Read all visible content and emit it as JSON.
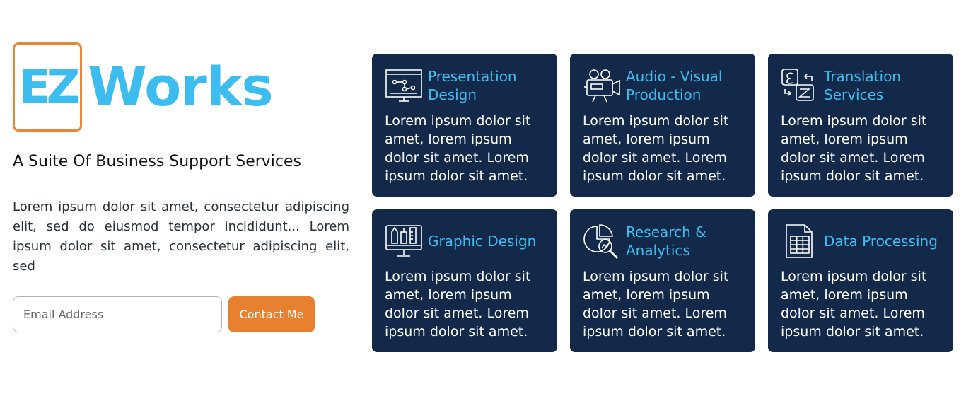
{
  "brand": {
    "logo_ez": "EZ",
    "logo_works": "Works",
    "tagline": "A Suite Of Business Support Services"
  },
  "intro": {
    "text": "Lorem ipsum dolor sit amet, consectetur adipiscing elit, sed do eiusmod tempor incididunt... Lorem ipsum dolor sit amet, consectetur adipiscing elit, sed"
  },
  "contact": {
    "email_placeholder": "Email Address",
    "button_label": "Contact Me"
  },
  "services": [
    {
      "title": "Presentation Design",
      "icon": "presentation-icon",
      "text": "Lorem ipsum dolor sit amet, lorem ipsum dolor sit amet. Lorem ipsum dolor sit amet."
    },
    {
      "title": "Audio - Visual Production",
      "icon": "video-camera-icon",
      "text": "Lorem ipsum dolor sit amet, lorem ipsum dolor sit amet. Lorem ipsum dolor sit amet."
    },
    {
      "title": "Translation Services",
      "icon": "translation-icon",
      "text": "Lorem ipsum dolor sit amet, lorem ipsum dolor sit amet. Lorem ipsum dolor sit amet."
    },
    {
      "title": "Graphic Design",
      "icon": "graphic-design-icon",
      "text": "Lorem ipsum dolor sit amet, lorem ipsum dolor sit amet. Lorem ipsum dolor sit amet."
    },
    {
      "title": "Research & Analytics",
      "icon": "research-analytics-icon",
      "text": "Lorem ipsum dolor sit amet, lorem ipsum dolor sit amet. Lorem ipsum dolor sit amet."
    },
    {
      "title": "Data Processing",
      "icon": "data-processing-icon",
      "text": "Lorem ipsum dolor sit amet, lorem ipsum dolor sit amet. Lorem ipsum dolor sit amet."
    }
  ],
  "colors": {
    "accent_blue": "#3dbcf0",
    "card_bg": "#12294a",
    "button_orange": "#e8812f",
    "logo_border": "#e8873a"
  }
}
